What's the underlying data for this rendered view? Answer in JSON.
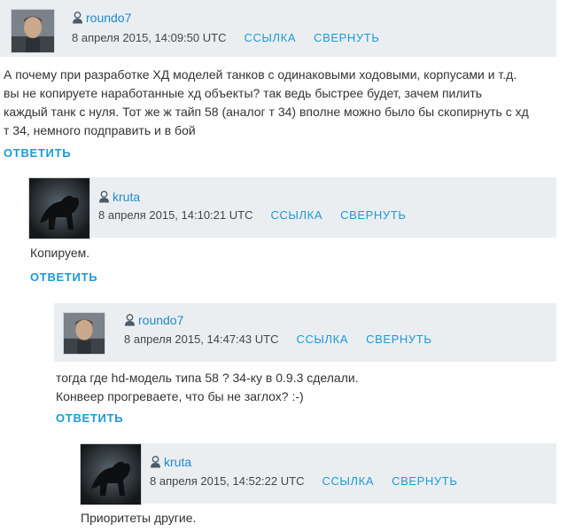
{
  "comments": [
    {
      "username": "roundo7",
      "datetime": "8 апреля 2015, 14:09:50 UTC",
      "link_label": "ССЫЛКА",
      "collapse_label": "СВЕРНУТЬ",
      "text": "А почему при разработке ХД моделей танков с одинаковыми ходовыми, корпусами и т.д.\nвы не копируете наработанные хд объекты? так ведь быстрее будет, зачем пилить\nкаждый танк с нуля. Тот же ж тайп 58 (аналог т 34) вполне можно было бы скопирнуть с хд\nт 34, немного подправить и в бой",
      "reply_label": "ОТВЕТИТЬ"
    },
    {
      "username": "kruta",
      "datetime": "8 апреля 2015, 14:10:21 UTC",
      "link_label": "ССЫЛКА",
      "collapse_label": "СВЕРНУТЬ",
      "text": "Копируем.",
      "reply_label": "ОТВЕТИТЬ"
    },
    {
      "username": "roundo7",
      "datetime": "8 апреля 2015, 14:47:43 UTC",
      "link_label": "ССЫЛКА",
      "collapse_label": "СВЕРНУТЬ",
      "text": "тогда где hd-модель типа 58 ? 34-ку в 0.9.3 сделали.\nКонвеер прогреваете, что бы не заглох? :-)",
      "reply_label": "ОТВЕТИТЬ"
    },
    {
      "username": "kruta",
      "datetime": "8 апреля 2015, 14:52:22 UTC",
      "link_label": "ССЫЛКА",
      "collapse_label": "СВЕРНУТЬ",
      "text": "Приоритеты другие."
    }
  ],
  "colors": {
    "header_bg": "#ebeef1",
    "link": "#1b9ad6",
    "username": "#1e8ac7",
    "text": "#333333"
  }
}
